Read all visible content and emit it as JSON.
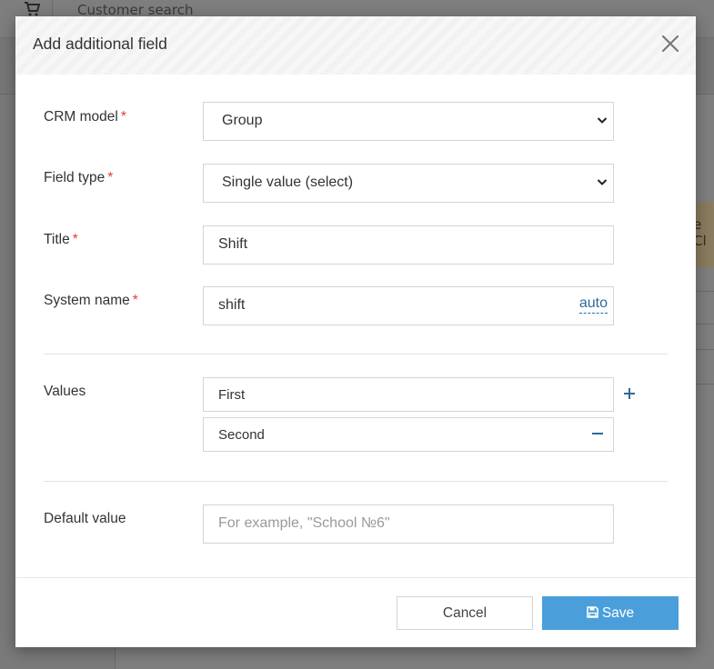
{
  "background": {
    "search_label": "Customer search",
    "warning_fragment": "e Cl"
  },
  "modal": {
    "title": "Add additional field",
    "fields": {
      "crm_model": {
        "label": "CRM model",
        "required": "*",
        "value": "Group"
      },
      "field_type": {
        "label": "Field type",
        "required": "*",
        "value": "Single value (select)"
      },
      "title": {
        "label": "Title",
        "required": "*",
        "value": "Shift"
      },
      "system_name": {
        "label": "System name",
        "required": "*",
        "value": "shift",
        "auto_link": "auto"
      }
    },
    "values": {
      "label": "Values",
      "items": [
        "First",
        "Second"
      ]
    },
    "default_value": {
      "label": "Default value",
      "placeholder": "For example, \"School №6\""
    },
    "footer": {
      "cancel_label": "Cancel",
      "save_label": "Save"
    }
  },
  "colors": {
    "accent": "#4a9fdb",
    "link": "#2c6b9c",
    "required": "#e23b3b"
  }
}
